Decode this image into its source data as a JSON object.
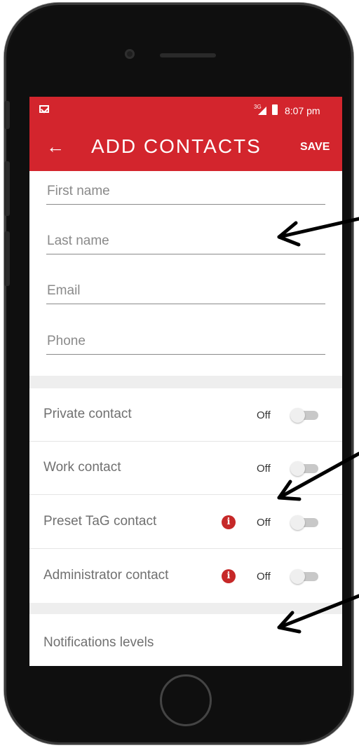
{
  "status_bar": {
    "network": "3G",
    "time": "8:07 pm"
  },
  "app_bar": {
    "back_icon": "back-arrow-icon",
    "title": "ADD CONTACTS",
    "save_label": "SAVE"
  },
  "form": {
    "first_name": {
      "placeholder": "First name",
      "value": ""
    },
    "last_name": {
      "placeholder": "Last name",
      "value": ""
    },
    "email": {
      "placeholder": "Email",
      "value": ""
    },
    "phone": {
      "placeholder": "Phone",
      "value": ""
    }
  },
  "toggles": [
    {
      "label": "Private contact",
      "state": "Off",
      "info": false
    },
    {
      "label": "Work contact",
      "state": "Off",
      "info": false
    },
    {
      "label": "Preset TaG contact",
      "state": "Off",
      "info": true
    },
    {
      "label": "Administrator contact",
      "state": "Off",
      "info": true
    }
  ],
  "notifications": {
    "label": "Notifications levels"
  },
  "colors": {
    "accent": "#d3252d",
    "info_icon": "#c62828",
    "separator": "#eeeeee"
  }
}
